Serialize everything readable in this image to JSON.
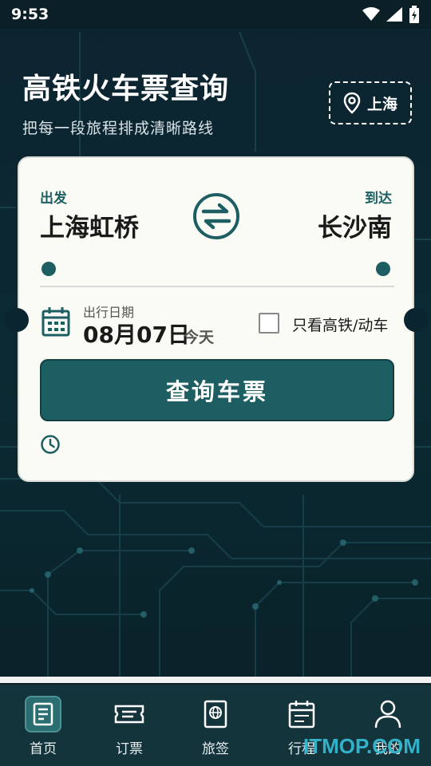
{
  "status_bar": {
    "time": "9:53"
  },
  "hero": {
    "title": "高铁火车票查询",
    "subtitle": "把每一段旅程排成清晰路线",
    "city": "上海"
  },
  "card": {
    "from_label": "出发",
    "from_station": "上海虹桥",
    "to_label": "到达",
    "to_station": "长沙南",
    "date_label": "出行日期",
    "date_value": "08月07日",
    "date_today": "今天",
    "highspeed_only_label": "只看高铁/动车",
    "highspeed_only_checked": false,
    "search_label": "查询车票"
  },
  "tabbar": {
    "items": [
      {
        "label": "首页",
        "icon": "home-doc-icon",
        "active": true
      },
      {
        "label": "订票",
        "icon": "ticket-icon",
        "active": false
      },
      {
        "label": "旅签",
        "icon": "passport-icon",
        "active": false
      },
      {
        "label": "行程",
        "icon": "calendar-icon",
        "active": false
      },
      {
        "label": "我的",
        "icon": "person-icon",
        "active": false
      }
    ]
  },
  "watermark": "ITMOP.COM",
  "colors": {
    "accent": "#1d5e62",
    "background": "#0b1d26",
    "card": "#fbfbf6"
  }
}
